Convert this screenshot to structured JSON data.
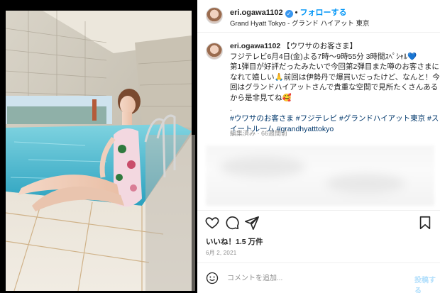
{
  "header": {
    "username": "eri.ogawa1102",
    "follow_label": "フォローする",
    "location": "Grand Hyatt Tokyo - グランド ハイアット 東京"
  },
  "caption": {
    "username": "eri.ogawa1102",
    "lines": [
      "【ウワサのお客さま】",
      "フジテレビ6月4日(金)よる7時〜9時55分 3時間ｽﾍﾟｼｬﾙ💙",
      "第1弾目が好評だったみたいで今回第2弾目また噂のお客さまに",
      "なれて嬉しい🙏前回は伊勢丹で爆買いだったけど、なんと！今",
      "回はグランドハイアットさんで貴重な空間で見所たくさんある",
      "から是非見てね🥰",
      "."
    ],
    "hashtag_lines": [
      "#ウワサのお客さま #フジテレビ #グランドハイアット東京 #ス",
      "イートルーム #grandhyatttokyo"
    ],
    "meta": "編集済み · 66週間前"
  },
  "actions": {
    "icons": [
      "heart-icon",
      "comment-icon",
      "share-icon",
      "bookmark-icon"
    ]
  },
  "likes": "いいね！1.5 万件",
  "date": "6月 2, 2021",
  "comment": {
    "placeholder": "コメントを追加...",
    "post_label": "投稿する"
  },
  "colors": {
    "link_blue": "#0095f6",
    "hashtag": "#00376b",
    "muted": "#8e8e8e",
    "pool_water": "#5ec4d8"
  }
}
